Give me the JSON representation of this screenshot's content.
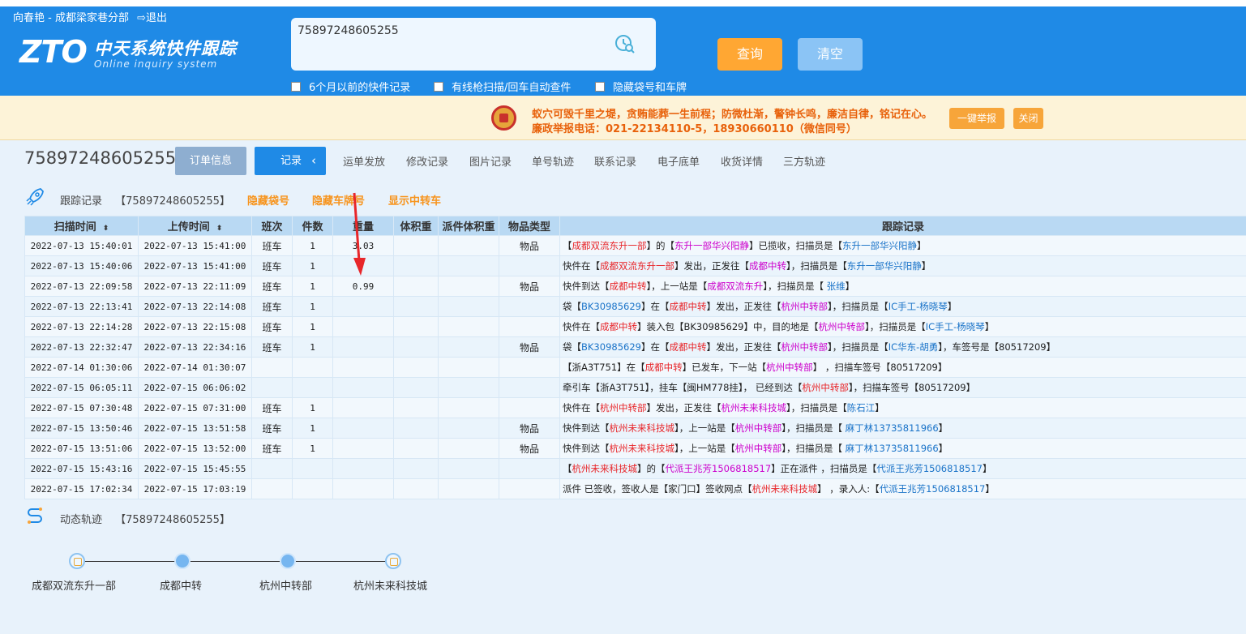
{
  "header": {
    "user_text": "向春艳 - 成都梁家巷分部",
    "logout_label": "退出",
    "logo_zto": "ZTO",
    "logo_cn": "中天系统快件跟踪",
    "logo_en": "Online inquiry system",
    "search_value": "75897248605255",
    "query_label": "查询",
    "clear_label": "清空",
    "options": [
      "6个月以前的快件记录",
      "有线枪扫描/回车自动查件",
      "隐藏袋号和车牌"
    ]
  },
  "notice": {
    "line1": "蚁穴可毁千里之堤，贪贿能葬一生前程；防微杜渐，警钟长鸣，廉洁自律，铭记在心。",
    "line2": "廉政举报电话：021-22134110-5，18930660110（微信同号）",
    "report_label": "一键举报",
    "close_label": "关闭"
  },
  "tabs": {
    "waybill": "75897248605255",
    "order_info": "订单信息",
    "record": "记录",
    "collapse_glyph": "‹",
    "items": [
      "运单发放",
      "修改记录",
      "图片记录",
      "单号轨迹",
      "联系记录",
      "电子底单",
      "收货详情",
      "三方轨迹"
    ]
  },
  "tracking": {
    "title": "跟踪记录",
    "number": "【75897248605255】",
    "links": [
      "隐藏袋号",
      "隐藏车牌号",
      "显示中转车"
    ],
    "columns": [
      "扫描时间",
      "上传时间",
      "班次",
      "件数",
      "重量",
      "体积重",
      "派件体积重",
      "物品类型",
      "跟踪记录"
    ],
    "sort_glyph": "⬍",
    "rows": [
      {
        "scan": "2022-07-13 15:40:01",
        "upload": "2022-07-13 15:41:00",
        "shift": "班车",
        "count": "1",
        "weight": "3.03",
        "vol": "",
        "dvol": "",
        "type": "物品",
        "log": [
          [
            "",
            "【"
          ],
          [
            "r",
            "成都双流东升一部"
          ],
          [
            "",
            "】的【"
          ],
          [
            "m",
            "东升一部华兴阳静"
          ],
          [
            "",
            "】已揽收，扫描员是【"
          ],
          [
            "b",
            "东升一部华兴阳静"
          ],
          [
            "",
            "】"
          ]
        ]
      },
      {
        "scan": "2022-07-13 15:40:06",
        "upload": "2022-07-13 15:41:00",
        "shift": "班车",
        "count": "1",
        "weight": "",
        "vol": "",
        "dvol": "",
        "type": "",
        "log": [
          [
            "",
            "快件在【"
          ],
          [
            "r",
            "成都双流东升一部"
          ],
          [
            "",
            "】发出，正发往【"
          ],
          [
            "m",
            "成都中转"
          ],
          [
            "",
            "】，扫描员是【"
          ],
          [
            "b",
            "东升一部华兴阳静"
          ],
          [
            "",
            "】"
          ]
        ]
      },
      {
        "scan": "2022-07-13 22:09:58",
        "upload": "2022-07-13 22:11:09",
        "shift": "班车",
        "count": "1",
        "weight": "0.99",
        "vol": "",
        "dvol": "",
        "type": "物品",
        "log": [
          [
            "",
            "快件到达【"
          ],
          [
            "r",
            "成都中转"
          ],
          [
            "",
            "】，上一站是【"
          ],
          [
            "m",
            "成都双流东升"
          ],
          [
            "",
            "】，扫描员是【 "
          ],
          [
            "b",
            "张维"
          ],
          [
            "",
            "】"
          ]
        ]
      },
      {
        "scan": "2022-07-13 22:13:41",
        "upload": "2022-07-13 22:14:08",
        "shift": "班车",
        "count": "1",
        "weight": "",
        "vol": "",
        "dvol": "",
        "type": "",
        "log": [
          [
            "",
            "袋【"
          ],
          [
            "b",
            "BK30985629"
          ],
          [
            "",
            "】在【"
          ],
          [
            "r",
            "成都中转"
          ],
          [
            "",
            "】发出，正发往【"
          ],
          [
            "m",
            "杭州中转部"
          ],
          [
            "",
            "】，扫描员是【"
          ],
          [
            "b",
            "IC手工-杨晓琴"
          ],
          [
            "",
            "】"
          ]
        ]
      },
      {
        "scan": "2022-07-13 22:14:28",
        "upload": "2022-07-13 22:15:08",
        "shift": "班车",
        "count": "1",
        "weight": "",
        "vol": "",
        "dvol": "",
        "type": "",
        "log": [
          [
            "",
            "快件在【"
          ],
          [
            "r",
            "成都中转"
          ],
          [
            "",
            "】装入包【BK30985629】中，目的地是【"
          ],
          [
            "m",
            "杭州中转部"
          ],
          [
            "",
            "】，扫描员是【"
          ],
          [
            "b",
            "IC手工-杨晓琴"
          ],
          [
            "",
            "】"
          ]
        ]
      },
      {
        "scan": "2022-07-13 22:32:47",
        "upload": "2022-07-13 22:34:16",
        "shift": "班车",
        "count": "1",
        "weight": "",
        "vol": "",
        "dvol": "",
        "type": "物品",
        "log": [
          [
            "",
            "袋【"
          ],
          [
            "b",
            "BK30985629"
          ],
          [
            "",
            "】在【"
          ],
          [
            "r",
            "成都中转"
          ],
          [
            "",
            "】发出，正发往【"
          ],
          [
            "m",
            "杭州中转部"
          ],
          [
            "",
            "】，扫描员是【"
          ],
          [
            "b",
            "IC华东-胡勇"
          ],
          [
            "",
            "】，车签号是【80517209】"
          ]
        ]
      },
      {
        "scan": "2022-07-14 01:30:06",
        "upload": "2022-07-14 01:30:07",
        "shift": "",
        "count": "",
        "weight": "",
        "vol": "",
        "dvol": "",
        "type": "",
        "log": [
          [
            "",
            "【浙A3T751】在【"
          ],
          [
            "r",
            "成都中转"
          ],
          [
            "",
            "】已发车，下一站【"
          ],
          [
            "m",
            "杭州中转部"
          ],
          [
            "",
            "】 ，扫描车签号【80517209】"
          ]
        ]
      },
      {
        "scan": "2022-07-15 06:05:11",
        "upload": "2022-07-15 06:06:02",
        "shift": "",
        "count": "",
        "weight": "",
        "vol": "",
        "dvol": "",
        "type": "",
        "log": [
          [
            "",
            "牵引车【浙A3T751】，挂车【闽HM778挂】， 已经到达【"
          ],
          [
            "r",
            "杭州中转部"
          ],
          [
            "",
            "】，扫描车签号【80517209】"
          ]
        ]
      },
      {
        "scan": "2022-07-15 07:30:48",
        "upload": "2022-07-15 07:31:00",
        "shift": "班车",
        "count": "1",
        "weight": "",
        "vol": "",
        "dvol": "",
        "type": "",
        "log": [
          [
            "",
            "快件在【"
          ],
          [
            "r",
            "杭州中转部"
          ],
          [
            "",
            "】发出，正发往【"
          ],
          [
            "m",
            "杭州未来科技城"
          ],
          [
            "",
            "】，扫描员是【"
          ],
          [
            "b",
            "陈石江"
          ],
          [
            "",
            "】"
          ]
        ]
      },
      {
        "scan": "2022-07-15 13:50:46",
        "upload": "2022-07-15 13:51:58",
        "shift": "班车",
        "count": "1",
        "weight": "",
        "vol": "",
        "dvol": "",
        "type": "物品",
        "log": [
          [
            "",
            "快件到达【"
          ],
          [
            "r",
            "杭州未来科技城"
          ],
          [
            "",
            "】，上一站是【"
          ],
          [
            "m",
            "杭州中转部"
          ],
          [
            "",
            "】，扫描员是【 "
          ],
          [
            "b",
            "麻丁林13735811966"
          ],
          [
            "",
            "】"
          ]
        ]
      },
      {
        "scan": "2022-07-15 13:51:06",
        "upload": "2022-07-15 13:52:00",
        "shift": "班车",
        "count": "1",
        "weight": "",
        "vol": "",
        "dvol": "",
        "type": "物品",
        "log": [
          [
            "",
            "快件到达【"
          ],
          [
            "r",
            "杭州未来科技城"
          ],
          [
            "",
            "】，上一站是【"
          ],
          [
            "m",
            "杭州中转部"
          ],
          [
            "",
            "】，扫描员是【 "
          ],
          [
            "b",
            "麻丁林13735811966"
          ],
          [
            "",
            "】"
          ]
        ]
      },
      {
        "scan": "2022-07-15 15:43:16",
        "upload": "2022-07-15 15:45:55",
        "shift": "",
        "count": "",
        "weight": "",
        "vol": "",
        "dvol": "",
        "type": "",
        "log": [
          [
            "",
            "【"
          ],
          [
            "r",
            "杭州未来科技城"
          ],
          [
            "",
            "】的【"
          ],
          [
            "m",
            "代派王兆芳1506818517"
          ],
          [
            "",
            "】正在派件 ，扫描员是【"
          ],
          [
            "b",
            "代派王兆芳1506818517"
          ],
          [
            "",
            "】"
          ]
        ]
      },
      {
        "scan": "2022-07-15 17:02:34",
        "upload": "2022-07-15 17:03:19",
        "shift": "",
        "count": "",
        "weight": "",
        "vol": "",
        "dvol": "",
        "type": "",
        "log": [
          [
            "",
            "派件 已签收，签收人是【家门口】签收网点【"
          ],
          [
            "r",
            "杭州未来科技城"
          ],
          [
            "",
            "】 ，录入人:【"
          ],
          [
            "b",
            "代派王兆芳1506818517"
          ],
          [
            "",
            "】"
          ]
        ]
      }
    ]
  },
  "route": {
    "title": "动态轨迹",
    "number": "【75897248605255】",
    "stops": [
      "成都双流东升一部",
      "成都中转",
      "杭州中转部",
      "杭州未来科技城"
    ]
  },
  "colors": {
    "header_blue": "#1f8ae6",
    "orange": "#ffa733",
    "red": "#e8262a",
    "magenta": "#cc00cc",
    "blue": "#1a73c8"
  }
}
